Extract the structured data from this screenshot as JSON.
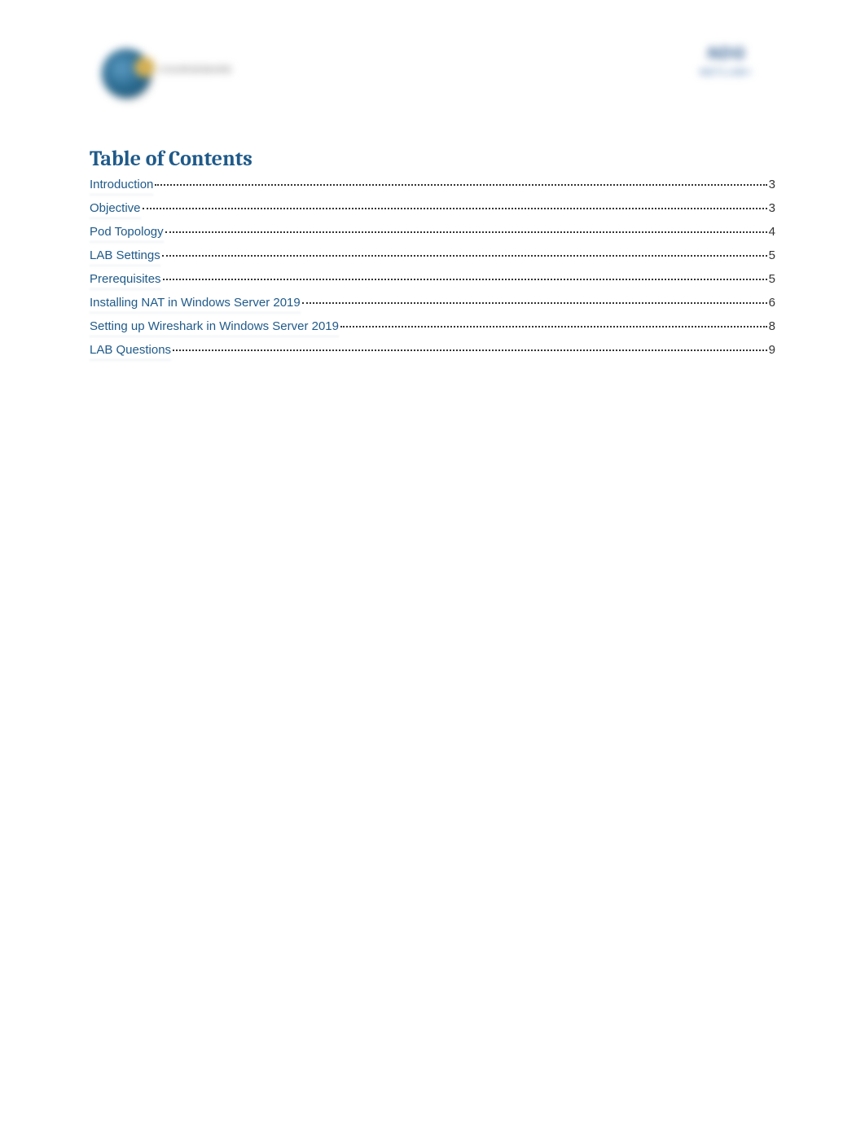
{
  "header": {
    "logo_left_text": "COURSEWARE",
    "logo_right_top": "NDG",
    "logo_right_bottom": "NETLAB+"
  },
  "toc": {
    "title": "Table of Contents",
    "entries": [
      {
        "label": "Introduction",
        "page": "3"
      },
      {
        "label": "Objective",
        "page": "3"
      },
      {
        "label": "Pod Topology",
        "page": "4"
      },
      {
        "label": "LAB Settings",
        "page": "5"
      },
      {
        "label": "Prerequisites",
        "page": "5"
      },
      {
        "label": "Installing NAT in Windows Server 2019",
        "page": "6"
      },
      {
        "label": "Setting up Wireshark in Windows Server 2019",
        "page": "8"
      },
      {
        "label": "LAB Questions",
        "page": "9"
      }
    ]
  }
}
